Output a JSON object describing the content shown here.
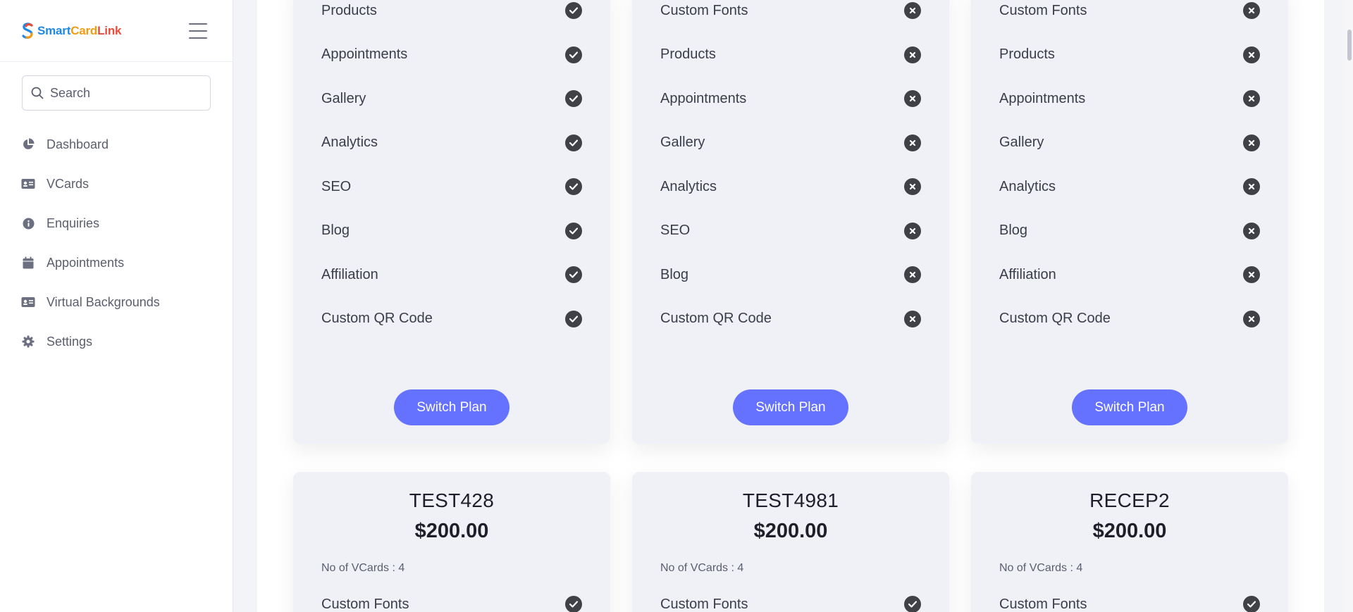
{
  "brand": {
    "name_part1": "Smart",
    "name_part2": "Card",
    "name_part3": "Link"
  },
  "search": {
    "placeholder": "Search"
  },
  "sidebar": {
    "items": [
      {
        "label": "Dashboard",
        "icon": "pie-chart-icon"
      },
      {
        "label": "VCards",
        "icon": "id-card-icon"
      },
      {
        "label": "Enquiries",
        "icon": "info-circle-icon"
      },
      {
        "label": "Appointments",
        "icon": "calendar-icon"
      },
      {
        "label": "Virtual Backgrounds",
        "icon": "id-card-icon"
      },
      {
        "label": "Settings",
        "icon": "gear-icon"
      }
    ]
  },
  "plans_top": [
    {
      "features": [
        {
          "label": "Products",
          "included": true
        },
        {
          "label": "Appointments",
          "included": true
        },
        {
          "label": "Gallery",
          "included": true
        },
        {
          "label": "Analytics",
          "included": true
        },
        {
          "label": "SEO",
          "included": true
        },
        {
          "label": "Blog",
          "included": true
        },
        {
          "label": "Affiliation",
          "included": true
        },
        {
          "label": "Custom QR Code",
          "included": true
        }
      ],
      "button": "Switch Plan"
    },
    {
      "features": [
        {
          "label": "Custom Fonts",
          "included": false
        },
        {
          "label": "Products",
          "included": false
        },
        {
          "label": "Appointments",
          "included": false
        },
        {
          "label": "Gallery",
          "included": false
        },
        {
          "label": "Analytics",
          "included": false
        },
        {
          "label": "SEO",
          "included": false
        },
        {
          "label": "Blog",
          "included": false
        },
        {
          "label": "Custom QR Code",
          "included": false
        }
      ],
      "button": "Switch Plan"
    },
    {
      "features": [
        {
          "label": "Custom Fonts",
          "included": false
        },
        {
          "label": "Products",
          "included": false
        },
        {
          "label": "Appointments",
          "included": false
        },
        {
          "label": "Gallery",
          "included": false
        },
        {
          "label": "Analytics",
          "included": false
        },
        {
          "label": "Blog",
          "included": false
        },
        {
          "label": "Affiliation",
          "included": false
        },
        {
          "label": "Custom QR Code",
          "included": false
        }
      ],
      "button": "Switch Plan"
    }
  ],
  "plans_bottom": [
    {
      "name": "TEST428",
      "price": "$200.00",
      "vcards": "No of VCards : 4",
      "first_feature": "Custom Fonts"
    },
    {
      "name": "TEST4981",
      "price": "$200.00",
      "vcards": "No of VCards : 4",
      "first_feature": "Custom Fonts"
    },
    {
      "name": "RECEP2",
      "price": "$200.00",
      "vcards": "No of VCards : 4",
      "first_feature": "Custom Fonts"
    }
  ],
  "colors": {
    "accent": "#6571ff",
    "badge": "#3f4147",
    "card_bg": "#eff1f6"
  }
}
